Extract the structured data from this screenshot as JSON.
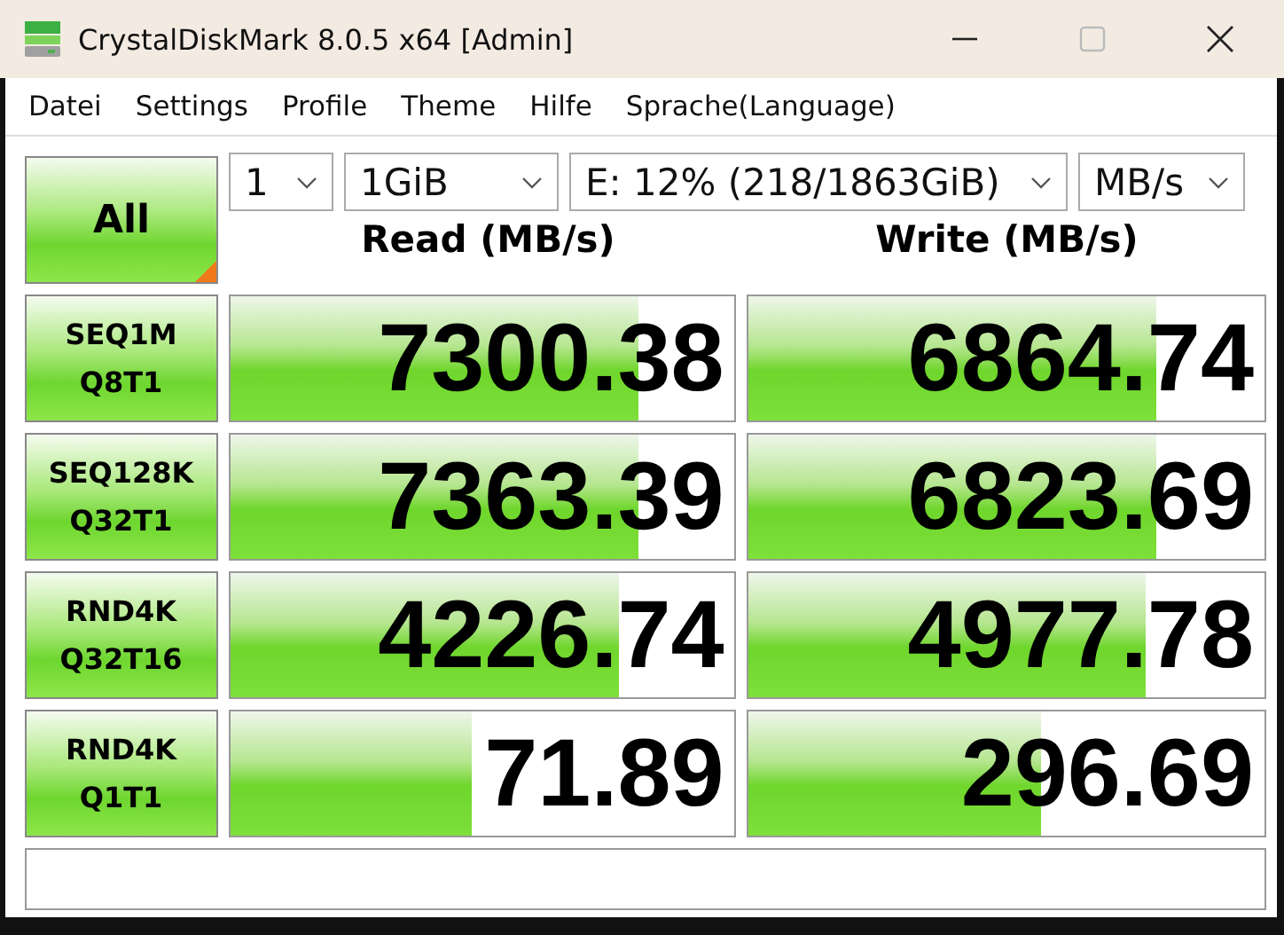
{
  "window": {
    "title": "CrystalDiskMark 8.0.5 x64 [Admin]"
  },
  "menu": [
    "Datei",
    "Settings",
    "Profile",
    "Theme",
    "Hilfe",
    "Sprache(Language)"
  ],
  "all_button": {
    "label": "All"
  },
  "selectors": [
    {
      "value": "1"
    },
    {
      "value": "1GiB"
    },
    {
      "value": "E: 12% (218/1863GiB)"
    },
    {
      "value": "MB/s"
    }
  ],
  "columns": [
    "Read (MB/s)",
    "Write (MB/s)"
  ],
  "rows": [
    {
      "test": "SEQ1M",
      "params": "Q8T1",
      "read": {
        "value": "7300.38",
        "level": 0.81
      },
      "write": {
        "value": "6864.74",
        "level": 0.79
      }
    },
    {
      "test": "SEQ128K",
      "params": "Q32T1",
      "read": {
        "value": "7363.39",
        "level": 0.81
      },
      "write": {
        "value": "6823.69",
        "level": 0.79
      }
    },
    {
      "test": "RND4K",
      "params": "Q32T16",
      "read": {
        "value": "4226.74",
        "level": 0.77
      },
      "write": {
        "value": "4977.78",
        "level": 0.77
      }
    },
    {
      "test": "RND4K",
      "params": "Q1T1",
      "read": {
        "value": "71.89",
        "level": 0.48
      },
      "write": {
        "value": "296.69",
        "level": 0.565
      }
    }
  ]
}
